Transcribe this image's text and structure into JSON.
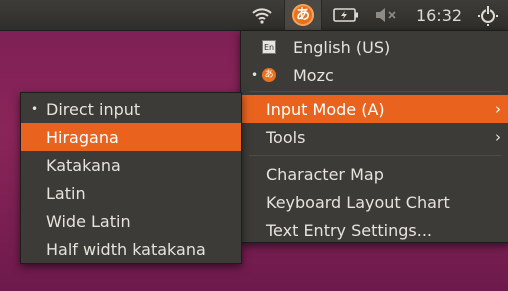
{
  "topbar": {
    "input_method_glyph": "あ",
    "time": "16:32",
    "icons": [
      "wifi-icon",
      "mozc-icon",
      "battery-icon",
      "volume-muted-icon",
      "power-icon"
    ]
  },
  "main_menu": {
    "items": [
      {
        "label": "English (US)",
        "icon_text": "En",
        "icon": "english-icon"
      },
      {
        "label": "Mozc",
        "icon_text": "あ",
        "icon": "mozc-icon",
        "selected": true
      },
      {
        "label": "Input Mode (A)",
        "submenu": true,
        "highlighted": true
      },
      {
        "label": "Tools",
        "submenu": true
      },
      {
        "label": "Character Map"
      },
      {
        "label": "Keyboard Layout Chart"
      },
      {
        "label": "Text Entry Settings..."
      }
    ]
  },
  "input_mode_menu": {
    "items": [
      {
        "label": "Direct input",
        "selected": true
      },
      {
        "label": "Hiragana",
        "highlighted": true
      },
      {
        "label": "Katakana"
      },
      {
        "label": "Latin"
      },
      {
        "label": "Wide Latin"
      },
      {
        "label": "Half width katakana"
      }
    ]
  },
  "symbols": {
    "bullet": "•",
    "arrow": "›"
  },
  "colors": {
    "highlight": "#E9631F",
    "menu_bg": "#3C3B37",
    "panel_bg": "#2F2E2B",
    "desktop": "#7B1F55"
  }
}
